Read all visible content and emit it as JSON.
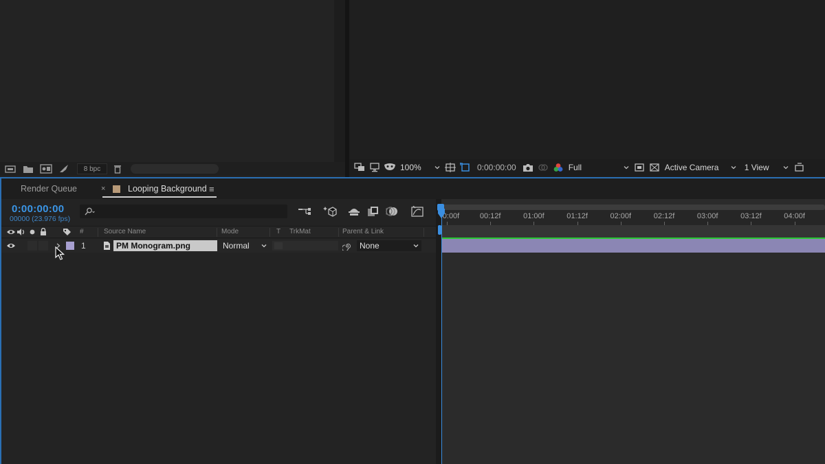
{
  "project_panel": {
    "footer": {
      "bpc_label": "8 bpc",
      "icons": [
        "interpret-footage-icon",
        "new-folder-icon",
        "new-composition-icon",
        "render-icon",
        "trash-icon"
      ]
    }
  },
  "viewer_toolbar": {
    "zoom": "100%",
    "timecode": "0:00:00:00",
    "resolution": "Full",
    "camera": "Active Camera",
    "views": "1 View"
  },
  "tabs": {
    "render_queue": "Render Queue",
    "close": "×",
    "composition": "Looping Background",
    "menu": "≡",
    "composition_color": "#b89a78"
  },
  "timeline": {
    "current_time": "0:00:00:00",
    "frame_info": "00000 (23.976 fps)",
    "columns": {
      "number": "#",
      "source_name": "Source Name",
      "mode": "Mode",
      "t": "T",
      "trkmat": "TrkMat",
      "parent": "Parent & Link"
    },
    "layers": [
      {
        "number": "1",
        "name": "PM Monogram.png",
        "mode": "Normal",
        "parent": "None",
        "label_color": "#a79fd0"
      }
    ],
    "ruler_labels": [
      "0:00f",
      "00:12f",
      "01:00f",
      "01:12f",
      "02:00f",
      "02:12f",
      "03:00f",
      "03:12f",
      "04:00f"
    ],
    "accent_color": "#3a8ee0",
    "bar_color": "#8b86b4"
  }
}
